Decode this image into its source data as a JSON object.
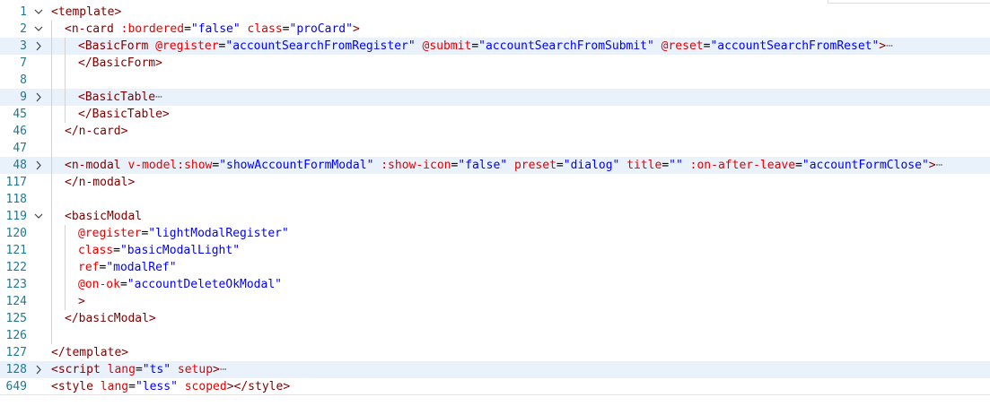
{
  "editor": {
    "ellipsis": "⋯",
    "lines": [
      {
        "num": "1",
        "fold": "expanded",
        "indent": 0,
        "folded": false,
        "tokens": [
          {
            "t": "<template>",
            "c": "tag"
          }
        ]
      },
      {
        "num": "2",
        "fold": "expanded",
        "indent": 1,
        "folded": false,
        "tokens": [
          {
            "t": "<n-card ",
            "c": "tag"
          },
          {
            "t": ":bordered",
            "c": "attr"
          },
          {
            "t": "=",
            "c": "plain"
          },
          {
            "t": "\"false\"",
            "c": "str"
          },
          {
            "t": " ",
            "c": "plain"
          },
          {
            "t": "class",
            "c": "attr"
          },
          {
            "t": "=",
            "c": "plain"
          },
          {
            "t": "\"proCard\"",
            "c": "str"
          },
          {
            "t": ">",
            "c": "tag"
          }
        ]
      },
      {
        "num": "3",
        "fold": "collapsed",
        "indent": 2,
        "folded": true,
        "ellipsis": true,
        "tokens": [
          {
            "t": "<BasicForm ",
            "c": "tag"
          },
          {
            "t": "@register",
            "c": "attr"
          },
          {
            "t": "=",
            "c": "plain"
          },
          {
            "t": "\"accountSearchFromRegister\"",
            "c": "str"
          },
          {
            "t": " ",
            "c": "plain"
          },
          {
            "t": "@submit",
            "c": "attr"
          },
          {
            "t": "=",
            "c": "plain"
          },
          {
            "t": "\"accountSearchFromSubmit\"",
            "c": "str"
          },
          {
            "t": " ",
            "c": "plain"
          },
          {
            "t": "@reset",
            "c": "attr"
          },
          {
            "t": "=",
            "c": "plain"
          },
          {
            "t": "\"accountSearchFromReset\"",
            "c": "str"
          },
          {
            "t": ">",
            "c": "tag"
          }
        ]
      },
      {
        "num": "7",
        "fold": "none",
        "indent": 2,
        "folded": false,
        "tokens": [
          {
            "t": "</BasicForm>",
            "c": "tag"
          }
        ]
      },
      {
        "num": "8",
        "fold": "none",
        "indent": 2,
        "folded": false,
        "tokens": []
      },
      {
        "num": "9",
        "fold": "collapsed",
        "indent": 2,
        "folded": true,
        "ellipsis": true,
        "tokens": [
          {
            "t": "<BasicTable",
            "c": "tag"
          }
        ]
      },
      {
        "num": "45",
        "fold": "none",
        "indent": 2,
        "folded": false,
        "tokens": [
          {
            "t": "</BasicTable>",
            "c": "tag"
          }
        ]
      },
      {
        "num": "46",
        "fold": "none",
        "indent": 1,
        "folded": false,
        "tokens": [
          {
            "t": "</n-card>",
            "c": "tag"
          }
        ]
      },
      {
        "num": "47",
        "fold": "none",
        "indent": 1,
        "folded": false,
        "tokens": []
      },
      {
        "num": "48",
        "fold": "collapsed",
        "indent": 1,
        "folded": true,
        "ellipsis": true,
        "tokens": [
          {
            "t": "<n-modal ",
            "c": "tag"
          },
          {
            "t": "v-model:show",
            "c": "attr"
          },
          {
            "t": "=",
            "c": "plain"
          },
          {
            "t": "\"showAccountFormModal\"",
            "c": "str"
          },
          {
            "t": " ",
            "c": "plain"
          },
          {
            "t": ":show-icon",
            "c": "attr"
          },
          {
            "t": "=",
            "c": "plain"
          },
          {
            "t": "\"false\"",
            "c": "str"
          },
          {
            "t": " ",
            "c": "plain"
          },
          {
            "t": "preset",
            "c": "attr"
          },
          {
            "t": "=",
            "c": "plain"
          },
          {
            "t": "\"dialog\"",
            "c": "str"
          },
          {
            "t": " ",
            "c": "plain"
          },
          {
            "t": "title",
            "c": "attr"
          },
          {
            "t": "=",
            "c": "plain"
          },
          {
            "t": "\"\"",
            "c": "str"
          },
          {
            "t": " ",
            "c": "plain"
          },
          {
            "t": ":on-after-leave",
            "c": "attr"
          },
          {
            "t": "=",
            "c": "plain"
          },
          {
            "t": "\"accountFormClose\"",
            "c": "str"
          },
          {
            "t": ">",
            "c": "tag"
          }
        ]
      },
      {
        "num": "117",
        "fold": "none",
        "indent": 1,
        "folded": false,
        "tokens": [
          {
            "t": "</n-modal>",
            "c": "tag"
          }
        ]
      },
      {
        "num": "118",
        "fold": "none",
        "indent": 1,
        "folded": false,
        "tokens": []
      },
      {
        "num": "119",
        "fold": "expanded",
        "indent": 1,
        "folded": false,
        "tokens": [
          {
            "t": "<basicModal",
            "c": "tag"
          }
        ]
      },
      {
        "num": "120",
        "fold": "none",
        "indent": 2,
        "folded": false,
        "tokens": [
          {
            "t": "@register",
            "c": "attr"
          },
          {
            "t": "=",
            "c": "plain"
          },
          {
            "t": "\"lightModalRegister\"",
            "c": "str"
          }
        ]
      },
      {
        "num": "121",
        "fold": "none",
        "indent": 2,
        "folded": false,
        "tokens": [
          {
            "t": "class",
            "c": "attr"
          },
          {
            "t": "=",
            "c": "plain"
          },
          {
            "t": "\"basicModalLight\"",
            "c": "str"
          }
        ]
      },
      {
        "num": "122",
        "fold": "none",
        "indent": 2,
        "folded": false,
        "tokens": [
          {
            "t": "ref",
            "c": "attr"
          },
          {
            "t": "=",
            "c": "plain"
          },
          {
            "t": "\"modalRef\"",
            "c": "str"
          }
        ]
      },
      {
        "num": "123",
        "fold": "none",
        "indent": 2,
        "folded": false,
        "tokens": [
          {
            "t": "@on-ok",
            "c": "attr"
          },
          {
            "t": "=",
            "c": "plain"
          },
          {
            "t": "\"accountDeleteOkModal\"",
            "c": "str"
          }
        ]
      },
      {
        "num": "124",
        "fold": "none",
        "indent": 2,
        "folded": false,
        "tokens": [
          {
            "t": ">",
            "c": "tag"
          }
        ]
      },
      {
        "num": "125",
        "fold": "none",
        "indent": 1,
        "folded": false,
        "tokens": [
          {
            "t": "</basicModal>",
            "c": "tag"
          }
        ]
      },
      {
        "num": "126",
        "fold": "none",
        "indent": 1,
        "folded": false,
        "tokens": []
      },
      {
        "num": "127",
        "fold": "none",
        "indent": 0,
        "folded": false,
        "tokens": [
          {
            "t": "</template>",
            "c": "tag"
          }
        ]
      },
      {
        "num": "128",
        "fold": "collapsed",
        "indent": 0,
        "folded": true,
        "ellipsis": true,
        "tokens": [
          {
            "t": "<script ",
            "c": "tag"
          },
          {
            "t": "lang",
            "c": "attr"
          },
          {
            "t": "=",
            "c": "plain"
          },
          {
            "t": "\"ts\"",
            "c": "str"
          },
          {
            "t": " ",
            "c": "plain"
          },
          {
            "t": "setup",
            "c": "attr"
          },
          {
            "t": ">",
            "c": "tag"
          }
        ]
      },
      {
        "num": "649",
        "fold": "none",
        "indent": 0,
        "folded": false,
        "tokens": [
          {
            "t": "<style ",
            "c": "tag"
          },
          {
            "t": "lang",
            "c": "attr"
          },
          {
            "t": "=",
            "c": "plain"
          },
          {
            "t": "\"less\"",
            "c": "str"
          },
          {
            "t": " ",
            "c": "plain"
          },
          {
            "t": "scoped",
            "c": "attr"
          },
          {
            "t": "></style>",
            "c": "tag"
          }
        ]
      }
    ]
  }
}
